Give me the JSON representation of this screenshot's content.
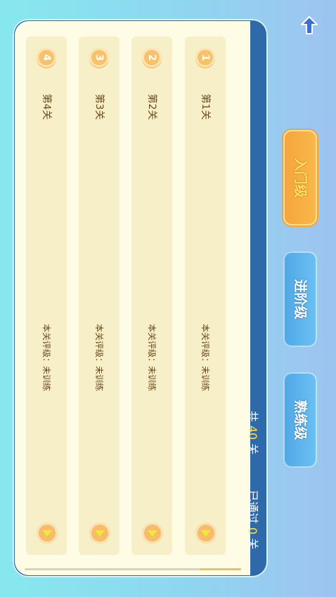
{
  "levels": [
    {
      "number": "1",
      "title": "第1关",
      "rating": "本关评级：未训练"
    },
    {
      "number": "2",
      "title": "第2关",
      "rating": "本关评级：未训练"
    },
    {
      "number": "3",
      "title": "第3关",
      "rating": "本关评级：未训练"
    },
    {
      "number": "4",
      "title": "第4关",
      "rating": "本关评级：未训练"
    }
  ],
  "stats": {
    "total_prefix": "共",
    "total_count": "40",
    "total_suffix": "关",
    "passed_prefix": "已通过",
    "passed_count": "0",
    "passed_suffix": "关"
  },
  "tabs": [
    {
      "label": "入门级",
      "active": true
    },
    {
      "label": "进阶级",
      "active": false
    },
    {
      "label": "熟练级",
      "active": false
    }
  ],
  "scroll_progress_fraction": 0.19,
  "icons": {
    "back": "up-arrow-icon",
    "play": "play-icon"
  },
  "colors": {
    "panel": "#2e6aaa",
    "card": "#f7efc7",
    "accent": "#f6a43b",
    "tab_blue": "#5ab4ea",
    "highlight": "#ffe34c"
  }
}
